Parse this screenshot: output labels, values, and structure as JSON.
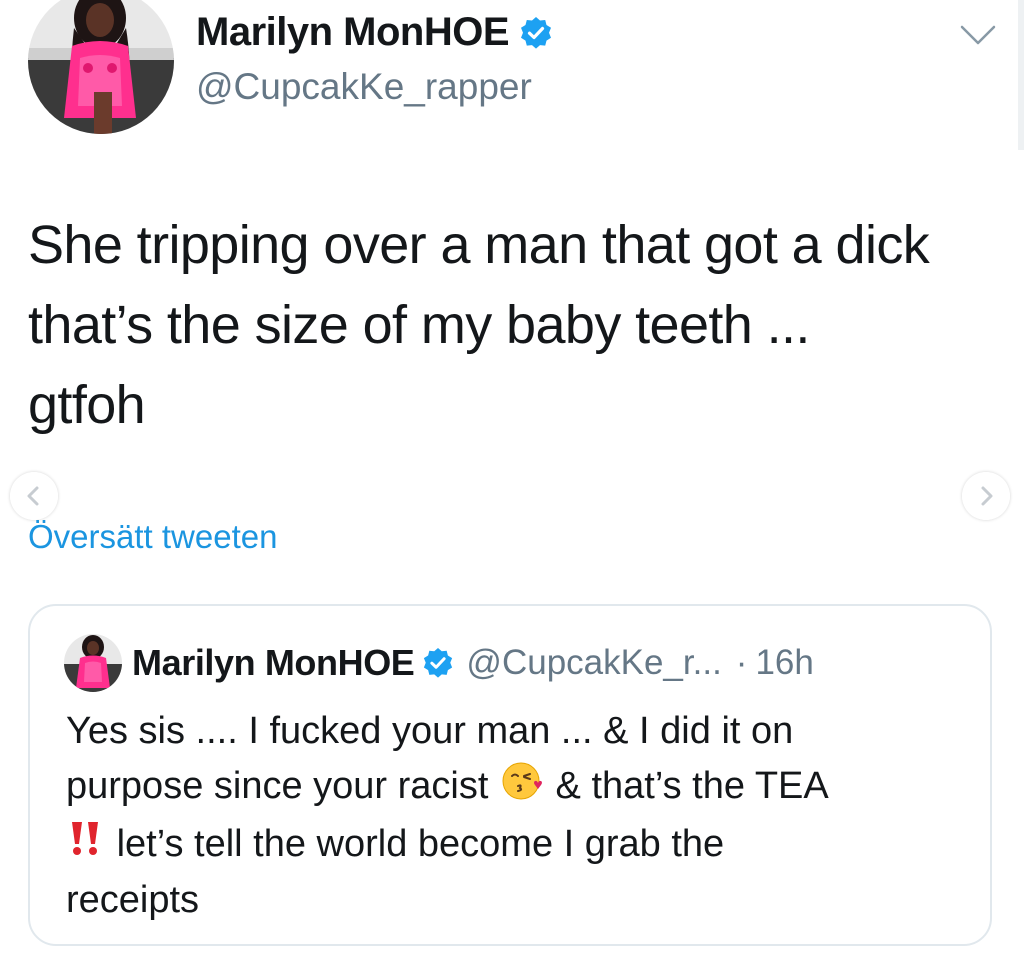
{
  "tweet": {
    "author": {
      "display_name": "Marilyn MonHOE",
      "handle": "@CupcakKe_rapper",
      "verified": true,
      "avatar": "profile-photo"
    },
    "menu_icon": "chevron-down-icon",
    "text_lines": [
      "She tripping over a man that got a dick",
      "that’s the size of my baby teeth ...",
      "gtfoh"
    ],
    "translate_label": "Översätt tweeten",
    "quoted_tweet": {
      "display_name": "Marilyn MonHOE",
      "handle": "@CupcakKe_r...",
      "dot": "·",
      "time": "16h",
      "line1": "Yes sis .... I fucked your man ... & I did it on",
      "line2_before_emoji": "purpose since your racist",
      "line2_emoji": "kissing-face-emoji",
      "line2_after_emoji": "& that’s the TEA",
      "line3_emoji": "double-exclamation-emoji",
      "line3_text": "let’s tell the world become I grab the",
      "line4": "receipts"
    }
  },
  "carousel": {
    "prev_icon": "chevron-left-icon",
    "next_icon": "chevron-right-icon"
  },
  "colors": {
    "link": "#1b95e0",
    "secondary_text": "#657786",
    "border": "#e1e8ed",
    "verified_badge": "#1da1f2"
  }
}
